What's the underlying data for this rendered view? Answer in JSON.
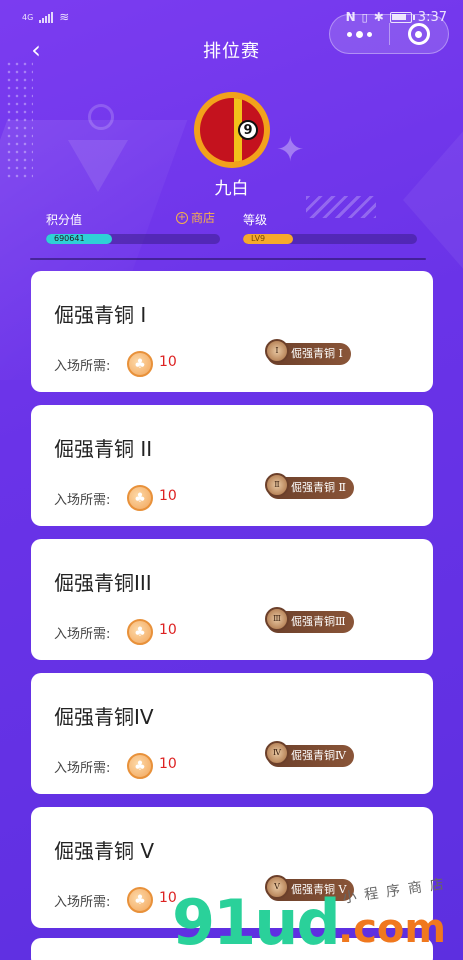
{
  "status_bar": {
    "network": "4G",
    "time": "3:37",
    "nfc_icon": "nfc-icon",
    "bluetooth_icon": "bluetooth-icon"
  },
  "nav": {
    "title": "排位赛"
  },
  "profile": {
    "name": "九白",
    "avatar_number": "9"
  },
  "stats": {
    "points_label": "积分值",
    "points_value": "690641",
    "points_progress": 0.38,
    "shop_label": "商店",
    "level_label": "等级",
    "level_value": "LV9",
    "level_progress": 0.29
  },
  "colors": {
    "background": "#6a33e8",
    "points_bar": "#2fd0d6",
    "level_bar": "#f6a92c",
    "require_value": "#dd2222",
    "shop_link": "#f6b04b"
  },
  "cards": [
    {
      "title": "倔强青铜 I",
      "require_label": "入场所需:",
      "require_value": "10",
      "badge_text": "倔强青铜 Ⅰ",
      "medal": "Ⅰ"
    },
    {
      "title": "倔强青铜 II",
      "require_label": "入场所需:",
      "require_value": "10",
      "badge_text": "倔强青铜 Ⅱ",
      "medal": "Ⅱ"
    },
    {
      "title": "倔强青铜III",
      "require_label": "入场所需:",
      "require_value": "10",
      "badge_text": "倔强青铜Ⅲ",
      "medal": "Ⅲ"
    },
    {
      "title": "倔强青铜IV",
      "require_label": "入场所需:",
      "require_value": "10",
      "badge_text": "倔强青铜Ⅳ",
      "medal": "Ⅳ"
    },
    {
      "title": "倔强青铜 V",
      "require_label": "入场所需:",
      "require_value": "10",
      "badge_text": "倔强青铜 Ⅴ",
      "medal": "Ⅴ"
    }
  ],
  "watermark": {
    "big": "91ud",
    "com": ".com",
    "small": "小程序商店"
  }
}
